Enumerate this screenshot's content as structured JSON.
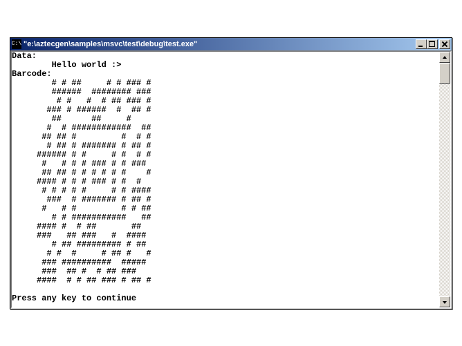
{
  "titlebar": {
    "icon_label": "C:\\",
    "title": "\"e:\\aztecgen\\samples\\msvc\\test\\debug\\test.exe\""
  },
  "console": {
    "data_label": "Data:",
    "data_value": "        Hello world :>",
    "barcode_label": "Barcode:",
    "barcode": [
      "   # # ##     # # ### #",
      "   ######  ######## ###",
      "    # #   #  # ## ### #",
      "  ### # ######  #  ## #",
      "   ##      ##     #",
      "  #  # ############  ##",
      " ## ## #         #  # #",
      "  # ## # ####### # ## #",
      "###### # #     # #  # #",
      " #   # # # ### # # ###",
      " ## ## # # # # # #    #",
      "#### # # # ### # #  #",
      " # # # # #     # # ####",
      "  ###  # ####### # ## #",
      " #   # #         # # ##",
      "   # # ###########   ##",
      "#### #  # ##       ##",
      "###   ## ###   #  ####",
      "   # ## ######### # ##",
      "  # #  #     # ## #   #",
      " ### ##########  #####",
      " ###  ## #  # ## ###",
      "####  # # ## ### # ## #"
    ],
    "prompt": "Press any key to continue"
  }
}
